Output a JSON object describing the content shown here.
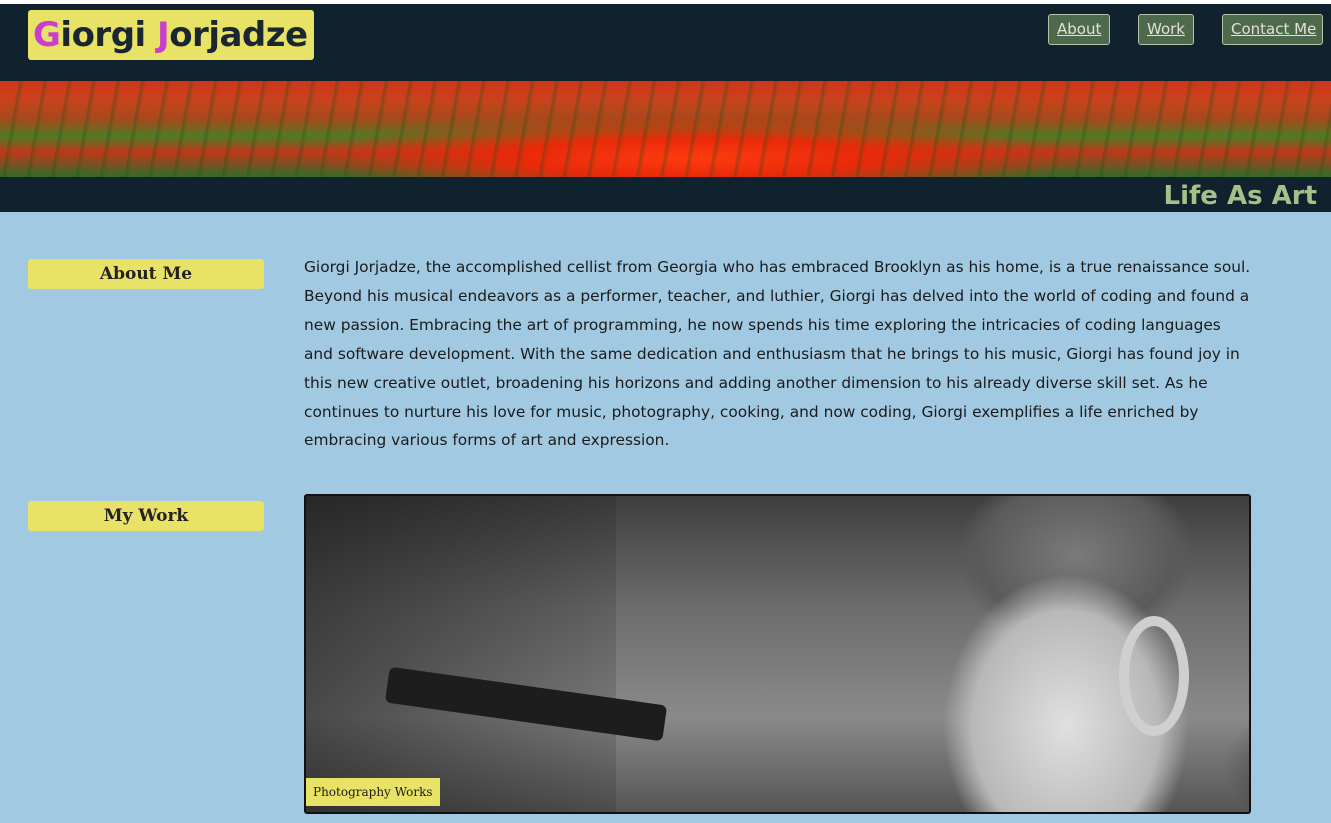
{
  "header": {
    "logo_initial_1": "G",
    "logo_rest_1": "iorgi ",
    "logo_initial_2": "J",
    "logo_rest_2": "orjadze",
    "nav": {
      "about": "About",
      "work": "Work",
      "contact": "Contact Me"
    }
  },
  "banner": {
    "tagline": "Life As Art"
  },
  "sections": {
    "about": {
      "heading": "About Me",
      "text": "Giorgi Jorjadze, the accomplished cellist from Georgia who has embraced Brooklyn as his home, is a true renaissance soul. Beyond his musical endeavors as a performer, teacher, and luthier, Giorgi has delved into the world of coding and found a new passion. Embracing the art of programming, he now spends his time exploring the intricacies of coding languages and software development. With the same dedication and enthusiasm that he brings to his music, Giorgi has found joy in this new creative outlet, broadening his horizons and adding another dimension to his already diverse skill set. As he continues to nurture his love for music, photography, cooking, and now coding, Giorgi exemplifies a life enriched by embracing various forms of art and expression."
    },
    "work": {
      "heading": "My Work",
      "caption": "Photography Works"
    }
  },
  "colors": {
    "header_bg": "#10222e",
    "page_bg": "#a2c9e2",
    "label_bg": "#e8e266",
    "logo_initial": "#c93ecf",
    "nav_bg": "#4d6a4c",
    "tagline": "#a9bf8a"
  }
}
